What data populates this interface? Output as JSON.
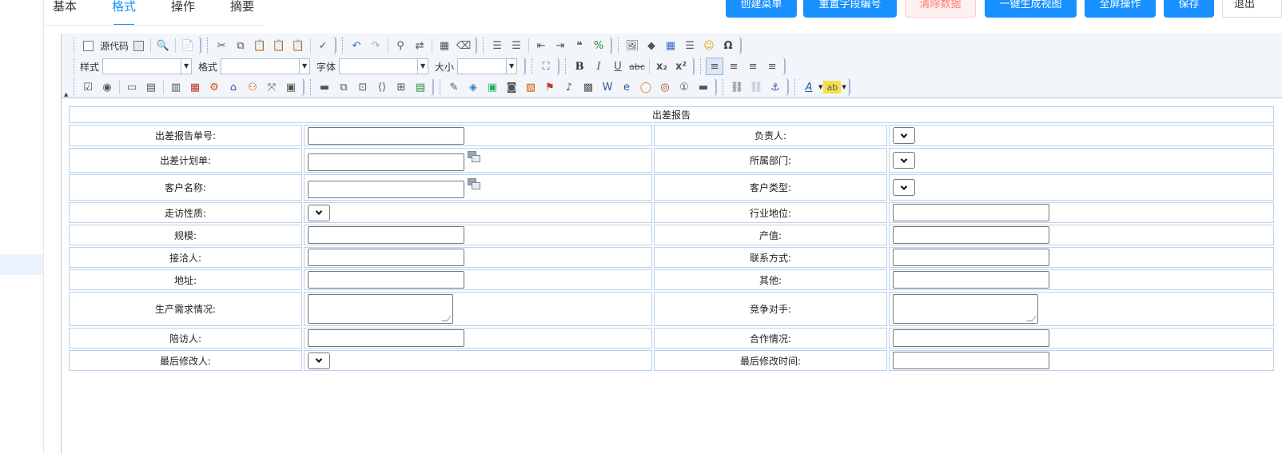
{
  "tabs": [
    "基本",
    "格式",
    "操作",
    "摘要"
  ],
  "active_tab": "格式",
  "actions": {
    "create_menu": "创建菜单",
    "reset_field_no": "重置字段编号",
    "clear_data": "清除数据",
    "generate_view": "一键生成视图",
    "fullscreen": "全屏操作",
    "save": "保存",
    "exit": "退出"
  },
  "toolbar": {
    "source_label": "源代码",
    "style_label": "样式",
    "format_label": "格式",
    "font_label": "字体",
    "size_label": "大小",
    "bold": "B",
    "italic": "I",
    "underline": "U",
    "strike": "abc",
    "subscript": "x₂",
    "superscript": "x²",
    "omega": "Ω",
    "font_color": "A",
    "highlight": "ab"
  },
  "form": {
    "title": "出差报告",
    "rows": [
      {
        "l1": "出差报告单号:",
        "l2": "负责人:"
      },
      {
        "l1": "出差计划单:",
        "l2": "所属部门:"
      },
      {
        "l1": "客户名称:",
        "l2": "客户类型:"
      },
      {
        "l1": "走访性质:",
        "l2": "行业地位:"
      },
      {
        "l1": "规模:",
        "l2": "产值:"
      },
      {
        "l1": "接洽人:",
        "l2": "联系方式:"
      },
      {
        "l1": "地址:",
        "l2": "其他:"
      },
      {
        "l1": "生产需求情况:",
        "l2": "竞争对手:"
      },
      {
        "l1": "陪访人:",
        "l2": "合作情况:"
      },
      {
        "l1": "最后修改人:",
        "l2": "最后修改时间:"
      }
    ]
  }
}
